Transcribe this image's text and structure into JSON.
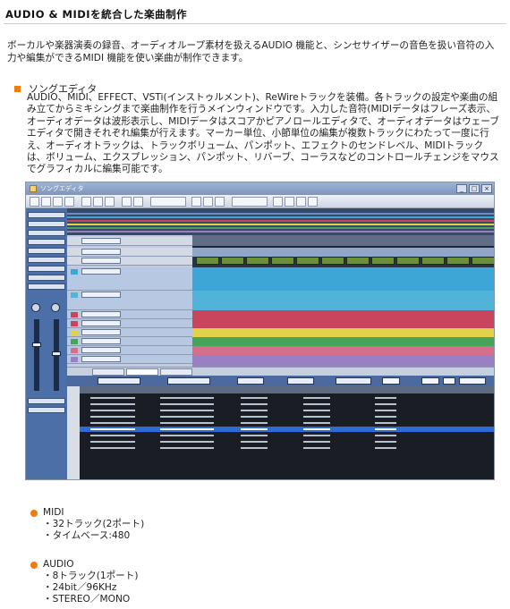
{
  "page": {
    "title": "AUDIO & MIDIを統合した楽曲制作",
    "intro": "ボーカルや楽器演奏の録音、オーディオループ素材を扱えるAUDIO 機能と、シンセサイザーの音色を扱い音符の入力や編集ができるMIDI 機能を使い楽曲が制作できます。"
  },
  "song_editor": {
    "heading": "ソングエディタ",
    "description": "AUDIO、MIDI、EFFECT、VSTi(インストゥルメント)、ReWireトラックを装備。各トラックの設定や楽曲の組み立てからミキシングまで楽曲制作を行うメインウィンドウです。入力した音符(MIDIデータはフレーズ表示、オーディオデータは波形表示し、MIDIデータはスコアかピアノロールエディタで、オーディオデータはウェーブエディタで開きそれぞれ編集が行えます。マーカー単位、小節単位の編集が複数トラックにわたって一度に行え、オーディオトラックは、トラックボリューム、パンポット、エフェクトのセンドレベル、MIDIトラックは、ボリューム、エクスプレッション、パンポット、リバーブ、コーラスなどのコントロールチェンジをマウスでグラフィカルに編集可能です。",
    "screenshot": {
      "window_title": "ソングエディタ",
      "bottom_tabs": [
        "テンプレ",
        "フレーズ",
        "ループ"
      ],
      "filter_labels": [
        "ジャンル",
        "楽器",
        "拍子",
        "タイプ",
        "構成"
      ],
      "filter_buttons": [
        "検索",
        "詳細検索",
        "閉",
        "ソング登録"
      ],
      "browser_columns": [
        "ファイル名",
        "ジャンル",
        "楽器",
        "拍子",
        "テンポ",
        "キー",
        "長さ",
        "ファイル種別",
        "タイプ",
        "キーワード"
      ],
      "lane_colors": [
        "#6b8dc9",
        "#3ea6d6",
        "#52b3d9",
        "#c9445d",
        "#e1d24a",
        "#45a45a",
        "#d36e8b",
        "#9a7fc5"
      ]
    }
  },
  "specs": {
    "midi": {
      "title": "MIDI",
      "items": [
        "・32トラック(2ポート)",
        "・タイムベース:480"
      ]
    },
    "audio": {
      "title": "AUDIO",
      "items": [
        "・8トラック(1ポート)",
        "・24bit／96KHz",
        "・STEREO／MONO"
      ]
    }
  },
  "colors": {
    "accent": "#f07c10"
  }
}
